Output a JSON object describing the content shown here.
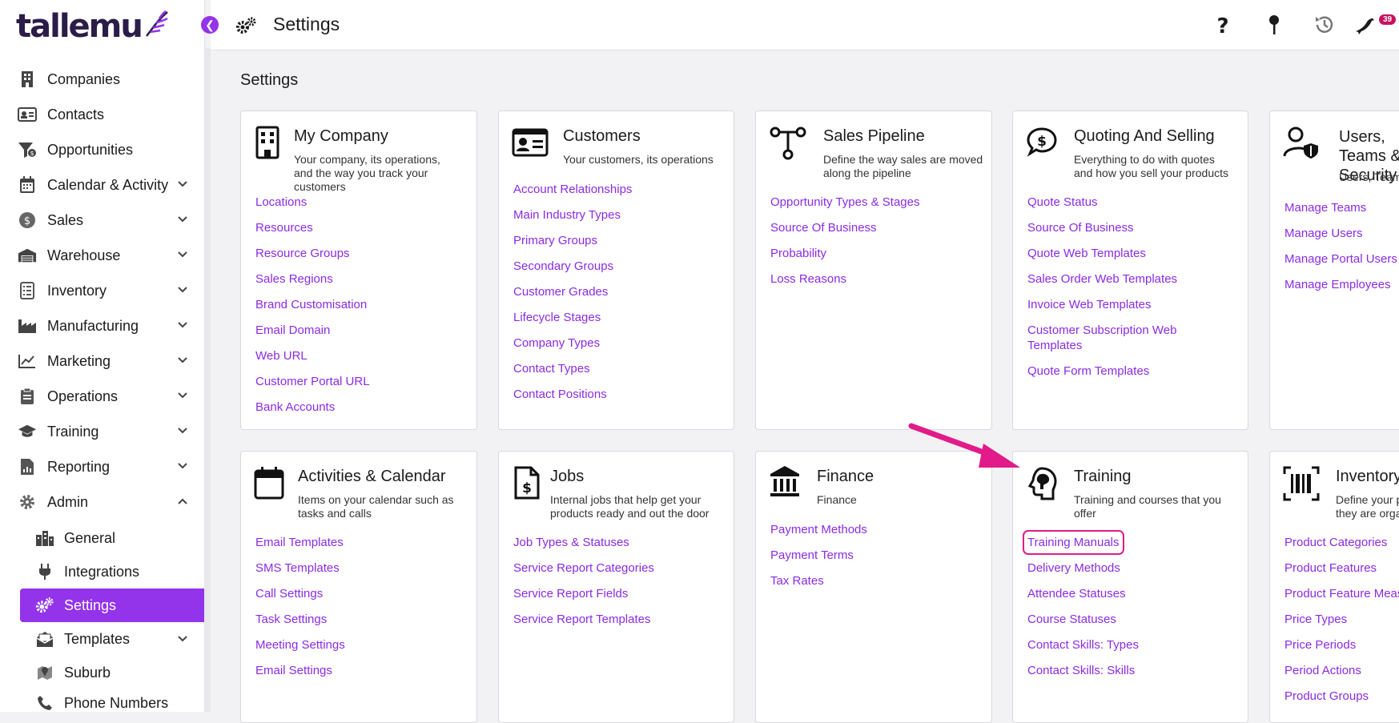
{
  "logo": {
    "text": "tallemu"
  },
  "topbar": {
    "title": "Settings",
    "notification_count": "39"
  },
  "page": {
    "heading": "Settings"
  },
  "sidebar": {
    "items": [
      {
        "label": "Companies",
        "icon": "building-icon",
        "has_chevron": false
      },
      {
        "label": "Contacts",
        "icon": "contact-card-icon",
        "has_chevron": false
      },
      {
        "label": "Opportunities",
        "icon": "funnel-dollar-icon",
        "has_chevron": false
      },
      {
        "label": "Calendar & Activity",
        "icon": "calendar-icon",
        "has_chevron": true
      },
      {
        "label": "Sales",
        "icon": "dollar-coin-icon",
        "has_chevron": true
      },
      {
        "label": "Warehouse",
        "icon": "warehouse-icon",
        "has_chevron": true
      },
      {
        "label": "Inventory",
        "icon": "clipboard-list-icon",
        "has_chevron": true
      },
      {
        "label": "Manufacturing",
        "icon": "factory-icon",
        "has_chevron": true
      },
      {
        "label": "Marketing",
        "icon": "chart-line-icon",
        "has_chevron": true
      },
      {
        "label": "Operations",
        "icon": "clipboard-icon",
        "has_chevron": true
      },
      {
        "label": "Training",
        "icon": "graduation-cap-icon",
        "has_chevron": true
      },
      {
        "label": "Reporting",
        "icon": "report-file-icon",
        "has_chevron": true
      },
      {
        "label": "Admin",
        "icon": "gear-icon",
        "has_chevron": true,
        "expanded": true
      }
    ],
    "sub_items": [
      {
        "label": "General",
        "icon": "city-icon"
      },
      {
        "label": "Integrations",
        "icon": "plug-icon"
      },
      {
        "label": "Settings",
        "icon": "gears-icon",
        "active": true
      },
      {
        "label": "Templates",
        "icon": "envelope-open-icon",
        "has_chevron": true
      },
      {
        "label": "Suburb",
        "icon": "map-marker-icon"
      },
      {
        "label": "Phone Numbers",
        "icon": "phone-icon"
      }
    ]
  },
  "cards": [
    {
      "title": "My Company",
      "description": "Your company, its operations, and the way you track your customers",
      "links": [
        "Locations",
        "Resources",
        "Resource Groups",
        "Sales Regions",
        "Brand Customisation",
        "Email Domain",
        "Web URL",
        "Customer Portal URL",
        "Bank Accounts"
      ]
    },
    {
      "title": "Customers",
      "description": "Your customers, its operations",
      "links": [
        "Account Relationships",
        "Main Industry Types",
        "Primary Groups",
        "Secondary Groups",
        "Customer Grades",
        "Lifecycle Stages",
        "Company Types",
        "Contact Types",
        "Contact Positions"
      ]
    },
    {
      "title": "Sales Pipeline",
      "description": "Define the way sales are moved along the pipeline",
      "links": [
        "Opportunity Types & Stages",
        "Source Of Business",
        "Probability",
        "Loss Reasons"
      ]
    },
    {
      "title": "Quoting And Selling",
      "description": "Everything to do with quotes and how you sell your products",
      "links": [
        "Quote Status",
        "Source Of Business",
        "Quote Web Templates",
        "Sales Order Web Templates",
        "Invoice Web Templates",
        "Customer Subscription Web Templates",
        "Quote Form Templates"
      ]
    },
    {
      "title": "Users, Teams & Security",
      "description": "Users, Teams",
      "links": [
        "Manage Teams",
        "Manage Users",
        "Manage Portal Users",
        "Manage Employees"
      ]
    },
    {
      "title": "Activities & Calendar",
      "description": "Items on your calendar such as tasks and calls",
      "links": [
        "Email Templates",
        "SMS Templates",
        "Call Settings",
        "Task Settings",
        "Meeting Settings",
        "Email Settings"
      ]
    },
    {
      "title": "Jobs",
      "description": "Internal jobs that help get your products ready and out the door",
      "links": [
        "Job Types & Statuses",
        "Service Report Categories",
        "Service Report Fields",
        "Service Report Templates"
      ]
    },
    {
      "title": "Finance",
      "description": "Finance",
      "links": [
        "Payment Methods",
        "Payment Terms",
        "Tax Rates"
      ]
    },
    {
      "title": "Training",
      "description": "Training and courses that you offer",
      "links": [
        "Training Manuals",
        "Delivery Methods",
        "Attendee Statuses",
        "Course Statuses",
        "Contact Skills: Types",
        "Contact Skills: Skills"
      ]
    },
    {
      "title": "Inventory",
      "description": "Define your products and how they are organised",
      "links": [
        "Product Categories",
        "Product Features",
        "Product Feature Measures",
        "Price Types",
        "Price Periods",
        "Period Actions",
        "Product Groups"
      ]
    }
  ],
  "colors": {
    "accent": "#9333ea",
    "link": "#8b2be2",
    "highlight": "#e11b8a",
    "badge": "#c8105e"
  }
}
